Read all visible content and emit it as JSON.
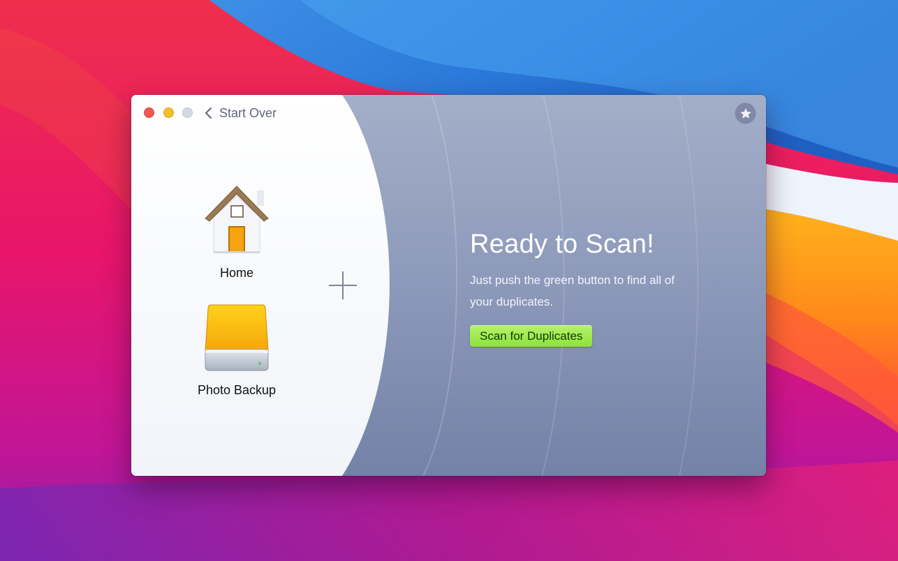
{
  "window": {
    "back_label": "Start Over",
    "traffic_lights": {
      "close_color": "#ee5a52",
      "minimize_color": "#f4c02a",
      "zoom_color": "#d3d8e2"
    }
  },
  "sources": [
    {
      "label": "Home",
      "icon": "home-folder-icon"
    },
    {
      "label": "Photo Backup",
      "icon": "external-drive-icon"
    }
  ],
  "add_source_icon": "plus-icon",
  "favorites_icon": "star-icon",
  "main": {
    "heading": "Ready to Scan!",
    "subtext": "Just push the green button to find all of your duplicates.",
    "scan_button": "Scan for Duplicates",
    "accent_color": "#9be94a"
  }
}
